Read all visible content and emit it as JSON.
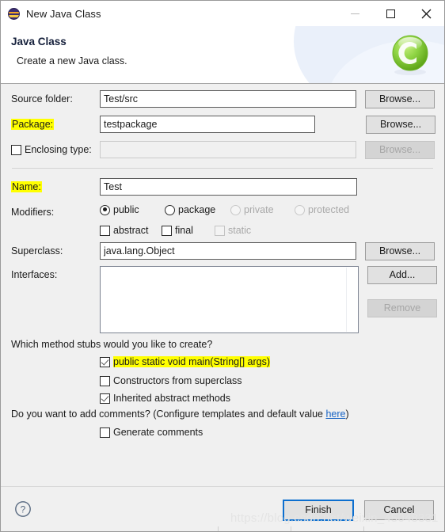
{
  "window": {
    "title": "New Java Class",
    "icon": "eclipse-globe-icon",
    "controls": {
      "minimize": "minimize",
      "maximize": "maximize",
      "close": "close"
    }
  },
  "header": {
    "title": "Java Class",
    "subtitle": "Create a new Java class.",
    "logo": "eclipse-c-logo"
  },
  "form": {
    "source_folder": {
      "label": "Source folder:",
      "value": "Test/src",
      "browse": "Browse..."
    },
    "package": {
      "label": "Package:",
      "value": "testpackage",
      "browse": "Browse...",
      "highlighted": true
    },
    "enclosing_type": {
      "label": "Enclosing type:",
      "value": "",
      "browse": "Browse...",
      "checked": false,
      "disabled": true
    },
    "name": {
      "label": "Name:",
      "value": "Test",
      "highlighted": true
    },
    "modifiers": {
      "label": "Modifiers:",
      "radios": [
        {
          "label": "public",
          "checked": true,
          "disabled": false
        },
        {
          "label": "package",
          "checked": false,
          "disabled": false
        },
        {
          "label": "private",
          "checked": false,
          "disabled": true
        },
        {
          "label": "protected",
          "checked": false,
          "disabled": true
        }
      ],
      "checkboxes": [
        {
          "label": "abstract",
          "checked": false,
          "disabled": false
        },
        {
          "label": "final",
          "checked": false,
          "disabled": false
        },
        {
          "label": "static",
          "checked": false,
          "disabled": true
        }
      ]
    },
    "superclass": {
      "label": "Superclass:",
      "value": "java.lang.Object",
      "browse": "Browse..."
    },
    "interfaces": {
      "label": "Interfaces:",
      "items": [],
      "add": "Add...",
      "remove": "Remove",
      "remove_disabled": true
    }
  },
  "stubs": {
    "question": "Which method stubs would you like to create?",
    "options": [
      {
        "label": "public static void main(String[] args)",
        "checked": true,
        "highlighted": true
      },
      {
        "label": "Constructors from superclass",
        "checked": false,
        "highlighted": false
      },
      {
        "label": "Inherited abstract methods",
        "checked": true,
        "highlighted": false
      }
    ]
  },
  "comments": {
    "question_prefix": "Do you want to add comments? (Configure templates and default value ",
    "link": "here",
    "question_suffix": ")",
    "option": {
      "label": "Generate comments",
      "checked": false
    }
  },
  "footer": {
    "help": "help-icon",
    "finish": "Finish",
    "cancel": "Cancel"
  },
  "watermark": "https://blog.csdn.net/weixin_45048331",
  "colors": {
    "highlight": "#ffff00",
    "link": "#1763c4",
    "focus": "#0d6fcf",
    "dialog_bg": "#f0f0f0"
  }
}
